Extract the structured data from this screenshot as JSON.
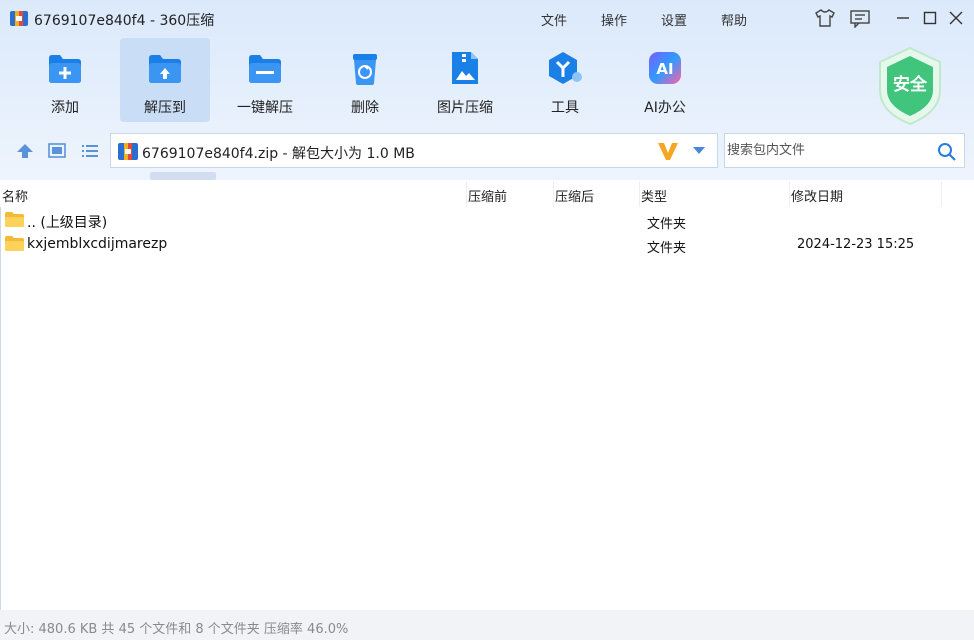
{
  "window": {
    "title": "6769107e840f4 - 360压缩"
  },
  "menu": {
    "file": "文件",
    "operate": "操作",
    "settings": "设置",
    "help": "帮助"
  },
  "toolbar": [
    {
      "label": "添加",
      "icon": "add-folder-icon"
    },
    {
      "label": "解压到",
      "icon": "extract-to-icon"
    },
    {
      "label": "一键解压",
      "icon": "one-click-extract-icon"
    },
    {
      "label": "删除",
      "icon": "delete-bin-icon"
    },
    {
      "label": "图片压缩",
      "icon": "image-compress-icon"
    },
    {
      "label": "工具",
      "icon": "tools-icon"
    },
    {
      "label": "AI办公",
      "icon": "ai-office-icon"
    }
  ],
  "security_badge": "安全",
  "address": {
    "path": "6769107e840f4.zip - 解包大小为 1.0 MB"
  },
  "search": {
    "placeholder": "搜索包内文件"
  },
  "columns": {
    "name": "名称",
    "before": "压缩前",
    "after": "压缩后",
    "type": "类型",
    "modified": "修改日期"
  },
  "rows": [
    {
      "name": ".. (上级目录)",
      "type": "文件夹",
      "modified": ""
    },
    {
      "name": "kxjemblxcdijmarezp",
      "type": "文件夹",
      "modified": "2024-12-23 15:25"
    }
  ],
  "status": {
    "text": "大小: 480.6 KB 共 45 个文件和 8 个文件夹 压缩率 46.0%"
  },
  "colors": {
    "accent": "#1a7fe6",
    "active_tool_bg": "#c9def6",
    "shield": "#41c47b"
  }
}
